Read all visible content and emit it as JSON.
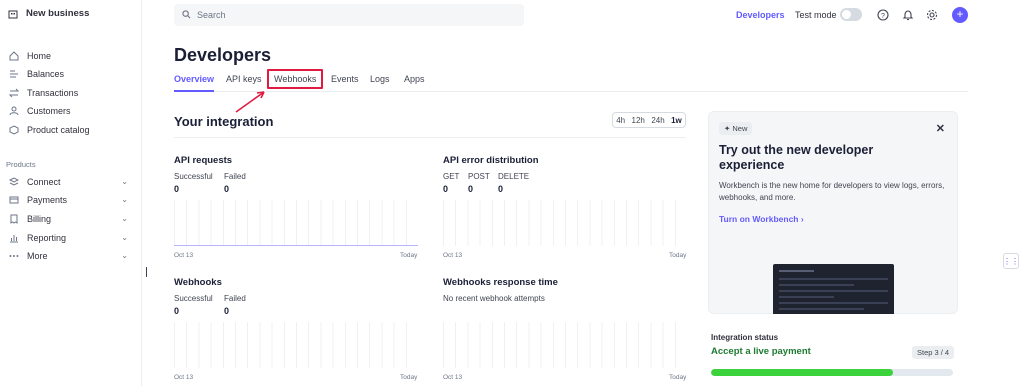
{
  "sidebar": {
    "brand": "New business",
    "items": [
      {
        "label": "Home",
        "icon": "home-icon"
      },
      {
        "label": "Balances",
        "icon": "balances-icon"
      },
      {
        "label": "Transactions",
        "icon": "transactions-icon"
      },
      {
        "label": "Customers",
        "icon": "customers-icon"
      },
      {
        "label": "Product catalog",
        "icon": "product-catalog-icon"
      }
    ],
    "section_label": "Products",
    "product_items": [
      {
        "label": "Connect",
        "icon": "connect-icon"
      },
      {
        "label": "Payments",
        "icon": "payments-icon"
      },
      {
        "label": "Billing",
        "icon": "billing-icon"
      },
      {
        "label": "Reporting",
        "icon": "reporting-icon"
      },
      {
        "label": "More",
        "icon": "more-icon"
      }
    ]
  },
  "topbar": {
    "search_placeholder": "Search",
    "developers_link": "Developers",
    "test_mode_label": "Test mode",
    "test_mode_on": false
  },
  "page": {
    "title": "Developers",
    "tabs": [
      "Overview",
      "API keys",
      "Webhooks",
      "Events",
      "Logs",
      "Apps"
    ],
    "active_tab": "Overview",
    "highlighted_tab": "Webhooks"
  },
  "integration": {
    "heading": "Your integration",
    "ranges": [
      "4h",
      "12h",
      "24h",
      "1w"
    ],
    "active_range": "1w",
    "api_requests": {
      "title": "API requests",
      "labels": [
        "Successful",
        "Failed"
      ],
      "values": [
        "0",
        "0"
      ],
      "axis_start": "Oct 13",
      "axis_end": "Today"
    },
    "api_errors": {
      "title": "API error distribution",
      "labels": [
        "GET",
        "POST",
        "DELETE"
      ],
      "values": [
        "0",
        "0",
        "0"
      ],
      "axis_start": "Oct 13",
      "axis_end": "Today"
    },
    "webhooks": {
      "title": "Webhooks",
      "labels": [
        "Successful",
        "Failed"
      ],
      "values": [
        "0",
        "0"
      ],
      "axis_start": "Oct 13",
      "axis_end": "Today"
    },
    "webhooks_response": {
      "title": "Webhooks response time",
      "empty_text": "No recent webhook attempts",
      "axis_start": "Oct 13",
      "axis_end": "Today"
    }
  },
  "promo": {
    "badge": "New",
    "title": "Try out the new developer experience",
    "body": "Workbench is the new home for developers to view logs, errors, webhooks, and more.",
    "link": "Turn on Workbench"
  },
  "status": {
    "title": "Integration status",
    "subtitle": "Accept a live payment",
    "step": "Step 3 / 4",
    "progress": 0.75
  },
  "colors": {
    "accent": "#635bff",
    "highlight": "#df1b41",
    "success": "#1c7a31",
    "progress": "#3cd23c"
  }
}
